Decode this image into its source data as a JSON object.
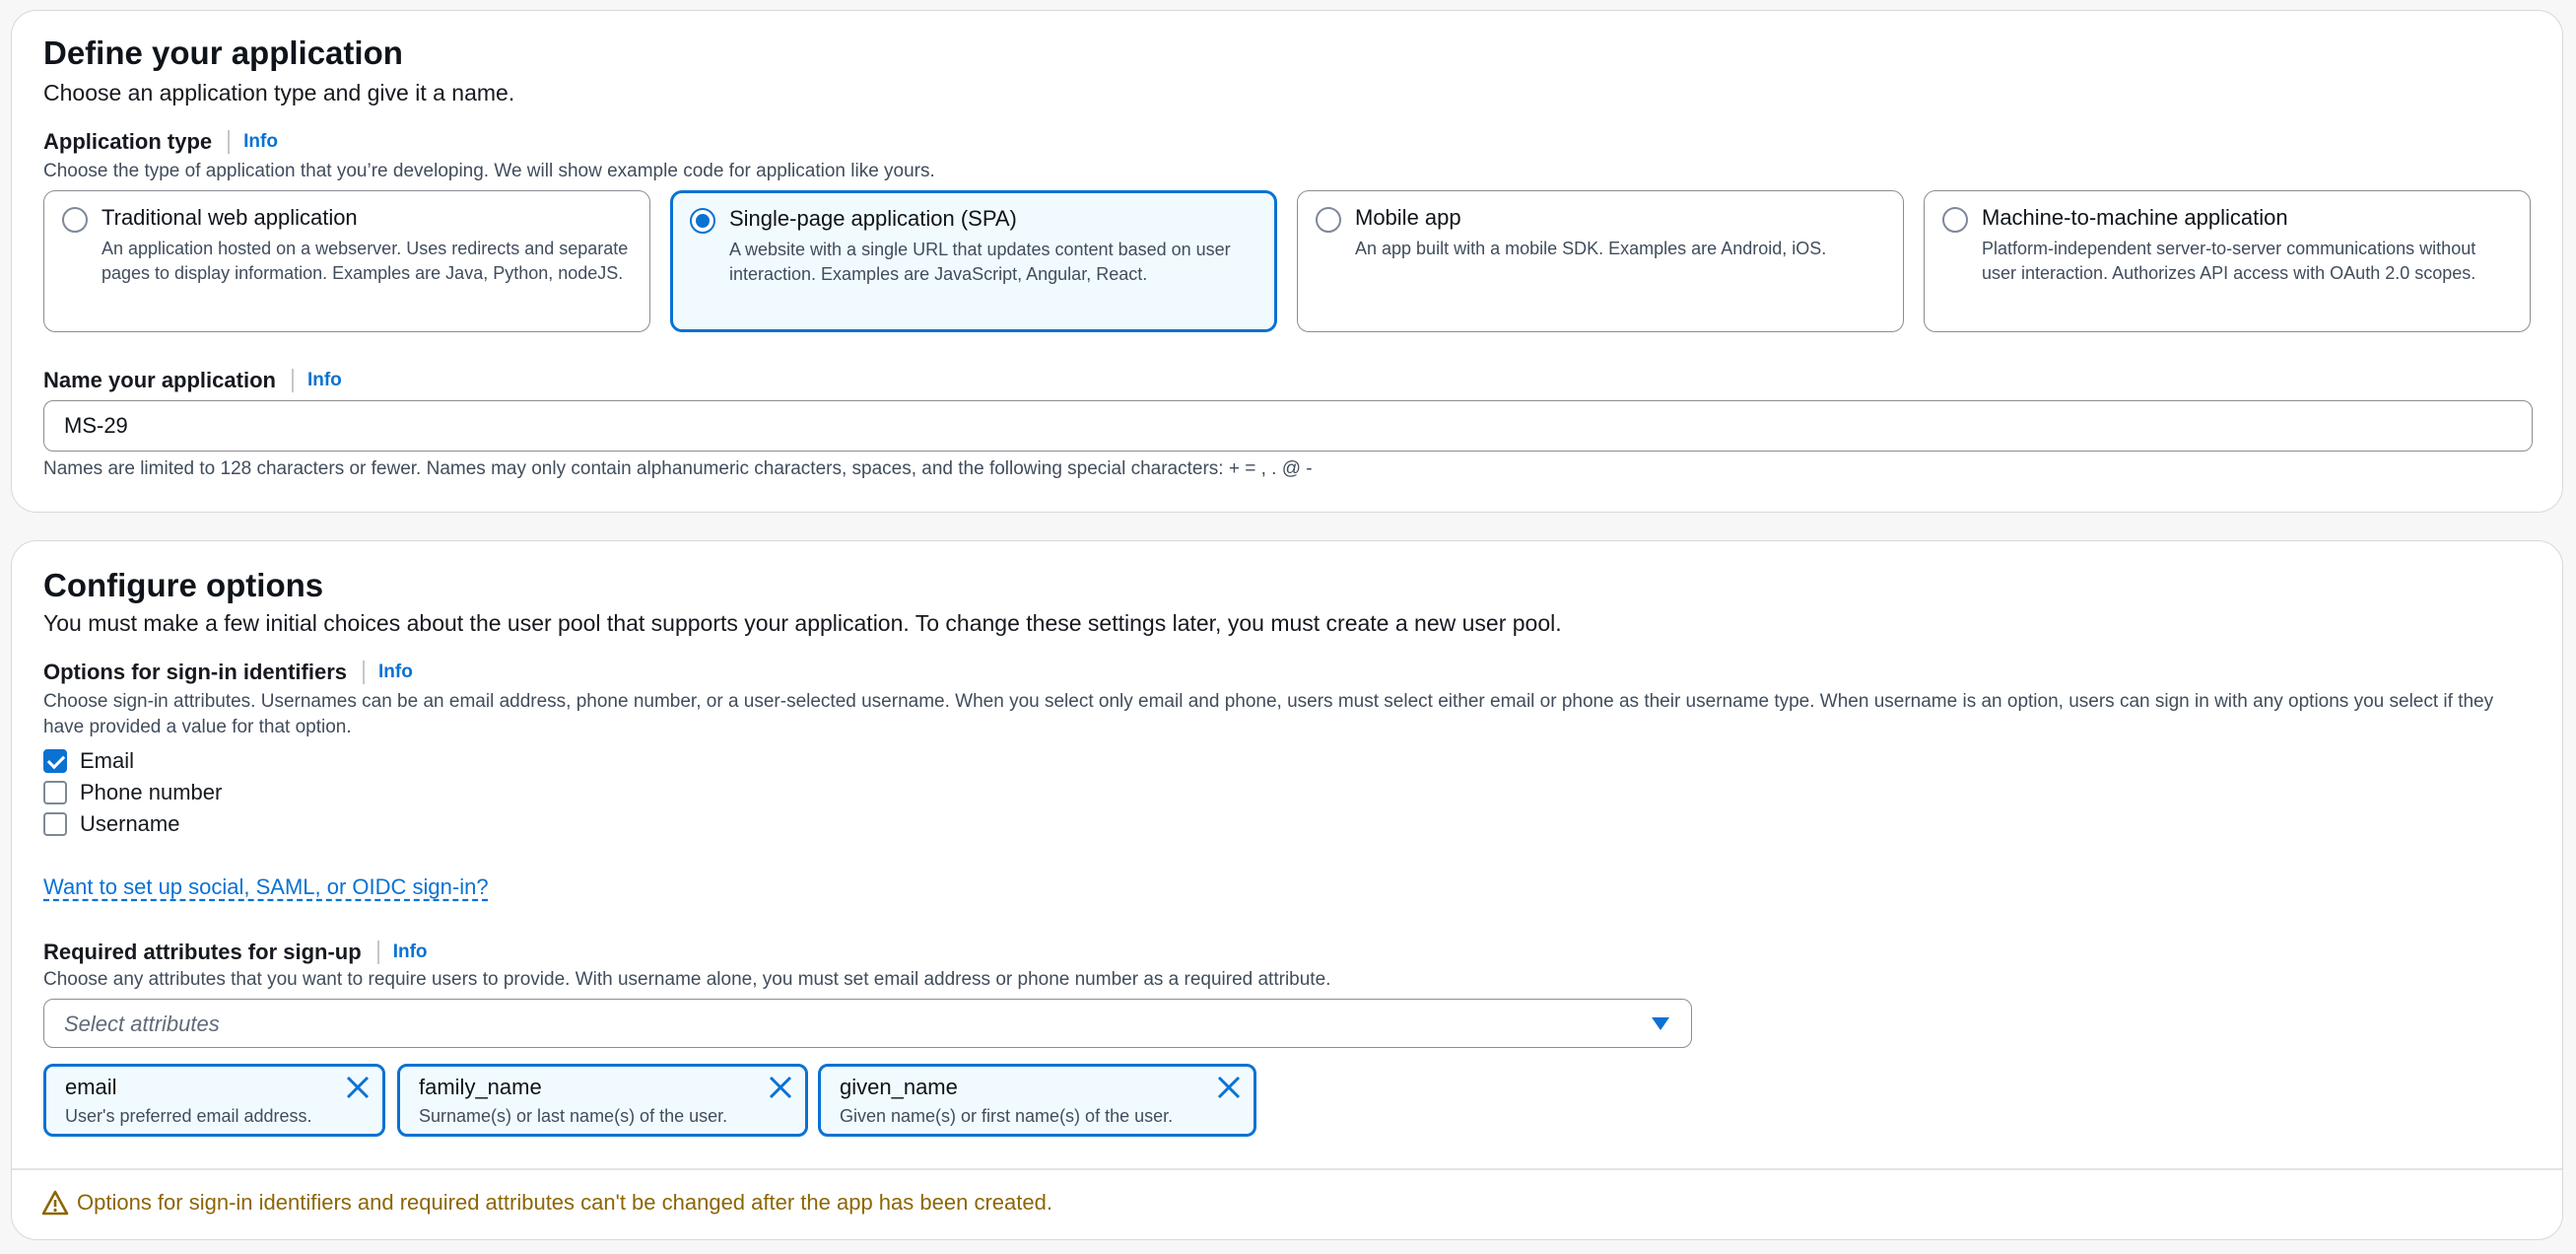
{
  "define": {
    "title": "Define your application",
    "description": "Choose an application type and give it a name.",
    "app_type": {
      "label": "Application type",
      "info": "Info",
      "hint": "Choose the type of application that you’re developing. We will show example code for application like yours.",
      "options": [
        {
          "title": "Traditional web application",
          "desc": "An application hosted on a webserver. Uses redirects and separate pages to display information. Examples are Java, Python, nodeJS.",
          "selected": false
        },
        {
          "title": "Single-page application (SPA)",
          "desc": "A website with a single URL that updates content based on user interaction. Examples are JavaScript, Angular, React.",
          "selected": true
        },
        {
          "title": "Mobile app",
          "desc": "An app built with a mobile SDK. Examples are Android, iOS.",
          "selected": false
        },
        {
          "title": "Machine-to-machine application",
          "desc": "Platform-independent server-to-server communications without user interaction. Authorizes API access with OAuth 2.0 scopes.",
          "selected": false
        }
      ]
    },
    "name": {
      "label": "Name your application",
      "info": "Info",
      "value": "MS-29",
      "hint": "Names are limited to 128 characters or fewer. Names may only contain alphanumeric characters, spaces, and the following special characters: + = , . @ -"
    }
  },
  "configure": {
    "title": "Configure options",
    "description": "You must make a few initial choices about the user pool that supports your application. To change these settings later, you must create a new user pool.",
    "signin": {
      "label": "Options for sign-in identifiers",
      "info": "Info",
      "hint": "Choose sign-in attributes. Usernames can be an email address, phone number, or a user-selected username. When you select only email and phone, users must select either email or phone as their username type. When username is an option, users can sign in with any options you select if they have provided a value for that option.",
      "options": [
        {
          "label": "Email",
          "checked": true
        },
        {
          "label": "Phone number",
          "checked": false
        },
        {
          "label": "Username",
          "checked": false
        }
      ]
    },
    "social_link": "Want to set up social, SAML, or OIDC sign-in?",
    "required": {
      "label": "Required attributes for sign-up",
      "info": "Info",
      "hint": "Choose any attributes that you want to require users to provide. With username alone, you must set email address or phone number as a required attribute.",
      "placeholder": "Select attributes",
      "tokens": [
        {
          "name": "email",
          "desc": "User's preferred email address."
        },
        {
          "name": "family_name",
          "desc": "Surname(s) or last name(s) of the user."
        },
        {
          "name": "given_name",
          "desc": "Given name(s) or first name(s) of the user."
        }
      ]
    },
    "warning": "Options for sign-in identifiers and required attributes can't be changed after the app has been created."
  },
  "colors": {
    "accent": "#0972d3",
    "warning": "#8d6605"
  },
  "icons": [
    "close-icon",
    "caret-down-icon",
    "warning-icon",
    "check-icon"
  ]
}
